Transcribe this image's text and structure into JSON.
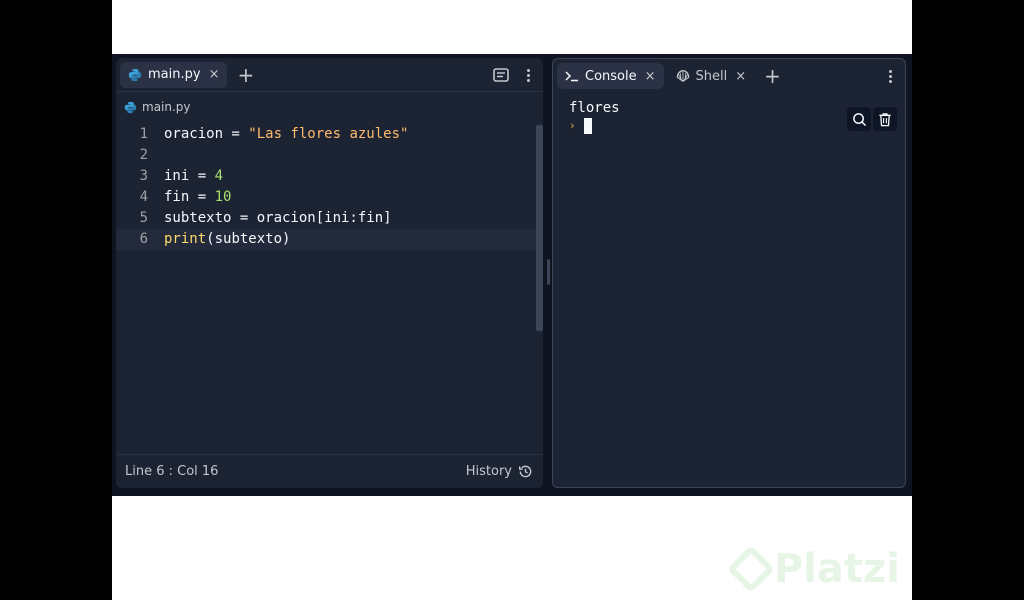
{
  "editor": {
    "tab": {
      "label": "main.py",
      "close": "×"
    },
    "add_tab": "+",
    "breadcrumb": "main.py",
    "lines": [
      {
        "n": "1",
        "parts": [
          [
            "oracion = ",
            "plain"
          ],
          [
            "\"Las flores azules\"",
            "str"
          ]
        ]
      },
      {
        "n": "2",
        "parts": []
      },
      {
        "n": "3",
        "parts": [
          [
            "ini = ",
            "plain"
          ],
          [
            "4",
            "num"
          ]
        ]
      },
      {
        "n": "4",
        "parts": [
          [
            "fin = ",
            "plain"
          ],
          [
            "10",
            "num"
          ]
        ]
      },
      {
        "n": "5",
        "parts": [
          [
            "subtexto = oracion[ini:fin]",
            "plain"
          ]
        ]
      },
      {
        "n": "6",
        "parts": [
          [
            "print",
            "fn"
          ],
          [
            "(subtexto)",
            "plain"
          ]
        ]
      }
    ],
    "current_line": 6,
    "status": "Line 6 : Col 16",
    "history_label": "History"
  },
  "console": {
    "tabs": [
      {
        "label": "Console",
        "icon": "terminal-icon",
        "close": "×"
      },
      {
        "label": "Shell",
        "icon": "shell-icon",
        "close": "×"
      }
    ],
    "add_tab": "+",
    "output": [
      "flores"
    ],
    "prompt": "›"
  },
  "colors": {
    "background": "#1c2333",
    "accent_string": "#ffbb6b",
    "accent_number": "#a8e06f",
    "accent_function": "#ffda6a"
  }
}
